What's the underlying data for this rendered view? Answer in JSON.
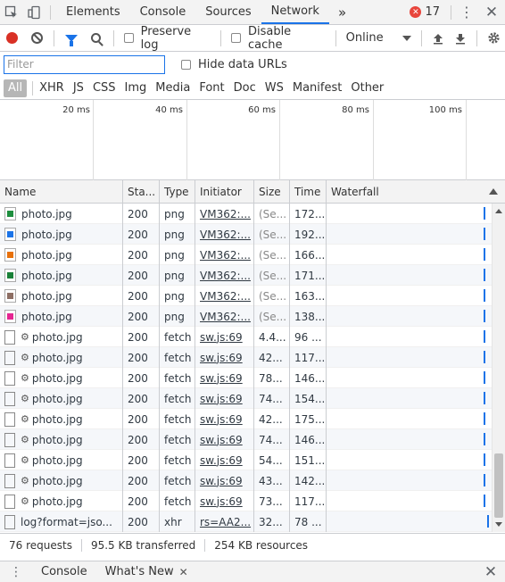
{
  "tabs": {
    "items": [
      {
        "label": "Elements"
      },
      {
        "label": "Console"
      },
      {
        "label": "Sources"
      },
      {
        "label": "Network"
      }
    ],
    "more": "»",
    "error_count": "17"
  },
  "toolbar": {
    "preserve_log": "Preserve log",
    "disable_cache": "Disable cache",
    "throttle": "Online"
  },
  "filter": {
    "placeholder": "Filter",
    "hide_data_urls": "Hide data URLs"
  },
  "types": [
    "All",
    "XHR",
    "JS",
    "CSS",
    "Img",
    "Media",
    "Font",
    "Doc",
    "WS",
    "Manifest",
    "Other"
  ],
  "overview": {
    "ticks": [
      "20 ms",
      "40 ms",
      "60 ms",
      "80 ms",
      "100 ms"
    ]
  },
  "columns": {
    "name": "Name",
    "status": "Sta...",
    "type": "Type",
    "initiator": "Initiator",
    "size": "Size",
    "time": "Time",
    "waterfall": "Waterfall"
  },
  "rows": [
    {
      "name": "photo.jpg",
      "status": "200",
      "type": "png",
      "initiator": "VM362:...",
      "size": "(Se...",
      "time": "172...",
      "icon_color": "#1e8e3e",
      "kind": "img"
    },
    {
      "name": "photo.jpg",
      "status": "200",
      "type": "png",
      "initiator": "VM362:...",
      "size": "(Se...",
      "time": "192...",
      "icon_color": "#1a73e8",
      "kind": "img"
    },
    {
      "name": "photo.jpg",
      "status": "200",
      "type": "png",
      "initiator": "VM362:...",
      "size": "(Se...",
      "time": "166...",
      "icon_color": "#e8710a",
      "kind": "img"
    },
    {
      "name": "photo.jpg",
      "status": "200",
      "type": "png",
      "initiator": "VM362:...",
      "size": "(Se...",
      "time": "171...",
      "icon_color": "#188038",
      "kind": "img"
    },
    {
      "name": "photo.jpg",
      "status": "200",
      "type": "png",
      "initiator": "VM362:...",
      "size": "(Se...",
      "time": "163...",
      "icon_color": "#8d6e63",
      "kind": "img"
    },
    {
      "name": "photo.jpg",
      "status": "200",
      "type": "png",
      "initiator": "VM362:...",
      "size": "(Se...",
      "time": "138...",
      "icon_color": "#e52592",
      "kind": "img"
    },
    {
      "name": "photo.jpg",
      "status": "200",
      "type": "fetch",
      "initiator": "sw.js:69",
      "size": "4.4...",
      "time": "96 ...",
      "kind": "fetch"
    },
    {
      "name": "photo.jpg",
      "status": "200",
      "type": "fetch",
      "initiator": "sw.js:69",
      "size": "42...",
      "time": "117...",
      "kind": "fetch"
    },
    {
      "name": "photo.jpg",
      "status": "200",
      "type": "fetch",
      "initiator": "sw.js:69",
      "size": "78...",
      "time": "146...",
      "kind": "fetch"
    },
    {
      "name": "photo.jpg",
      "status": "200",
      "type": "fetch",
      "initiator": "sw.js:69",
      "size": "74...",
      "time": "154...",
      "kind": "fetch"
    },
    {
      "name": "photo.jpg",
      "status": "200",
      "type": "fetch",
      "initiator": "sw.js:69",
      "size": "42...",
      "time": "175...",
      "kind": "fetch"
    },
    {
      "name": "photo.jpg",
      "status": "200",
      "type": "fetch",
      "initiator": "sw.js:69",
      "size": "74...",
      "time": "146...",
      "kind": "fetch"
    },
    {
      "name": "photo.jpg",
      "status": "200",
      "type": "fetch",
      "initiator": "sw.js:69",
      "size": "54...",
      "time": "151...",
      "kind": "fetch"
    },
    {
      "name": "photo.jpg",
      "status": "200",
      "type": "fetch",
      "initiator": "sw.js:69",
      "size": "43...",
      "time": "142...",
      "kind": "fetch"
    },
    {
      "name": "photo.jpg",
      "status": "200",
      "type": "fetch",
      "initiator": "sw.js:69",
      "size": "73...",
      "time": "117...",
      "kind": "fetch"
    },
    {
      "name": "log?format=jso...",
      "status": "200",
      "type": "xhr",
      "initiator": "rs=AA2...",
      "size": "32...",
      "time": "78 ...",
      "kind": "xhr"
    }
  ],
  "status": {
    "requests": "76 requests",
    "transferred": "95.5 KB transferred",
    "resources": "254 KB resources"
  },
  "drawer": {
    "tabs": [
      {
        "label": "Console"
      },
      {
        "label": "What's New"
      }
    ]
  },
  "colors": {
    "accent": "#1a73e8",
    "record": "#d93025",
    "error": "#e8453c"
  }
}
